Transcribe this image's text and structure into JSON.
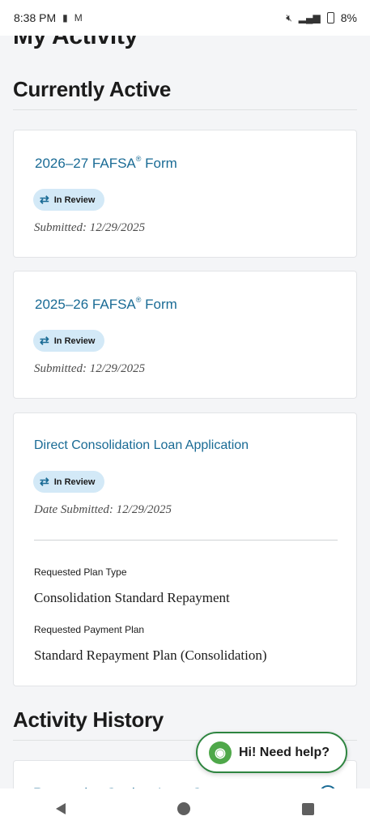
{
  "status_bar": {
    "time": "8:38 PM",
    "left_icons": [
      "▮",
      "M"
    ],
    "battery": "8%"
  },
  "page_title": "My Activity",
  "currently_active": {
    "heading": "Currently Active",
    "cards": [
      {
        "title": "2026–27 FAFSA",
        "title_mark": "®",
        "title_suffix": " Form",
        "status": "In Review",
        "submitted": "Submitted: 12/29/2025"
      },
      {
        "title": "2025–26 FAFSA",
        "title_mark": "®",
        "title_suffix": " Form",
        "status": "In Review",
        "submitted": "Submitted: 12/29/2025"
      },
      {
        "title": "Direct Consolidation Loan Application",
        "status": "In Review",
        "submitted": "Date Submitted: 12/29/2025",
        "plan_type_label": "Requested Plan Type",
        "plan_type_value": "Consolidation Standard Repayment",
        "payment_plan_label": "Requested Payment Plan",
        "payment_plan_value": "Standard Repayment Plan (Consolidation)"
      }
    ]
  },
  "activity_history": {
    "heading": "Activity History",
    "first_item": "Requesting Student Loan Statement"
  },
  "help": {
    "label": "Hi! Need help?"
  },
  "colors": {
    "link": "#1a6b95",
    "pill_bg": "#d3e9f7",
    "help_border": "#2e8540"
  }
}
